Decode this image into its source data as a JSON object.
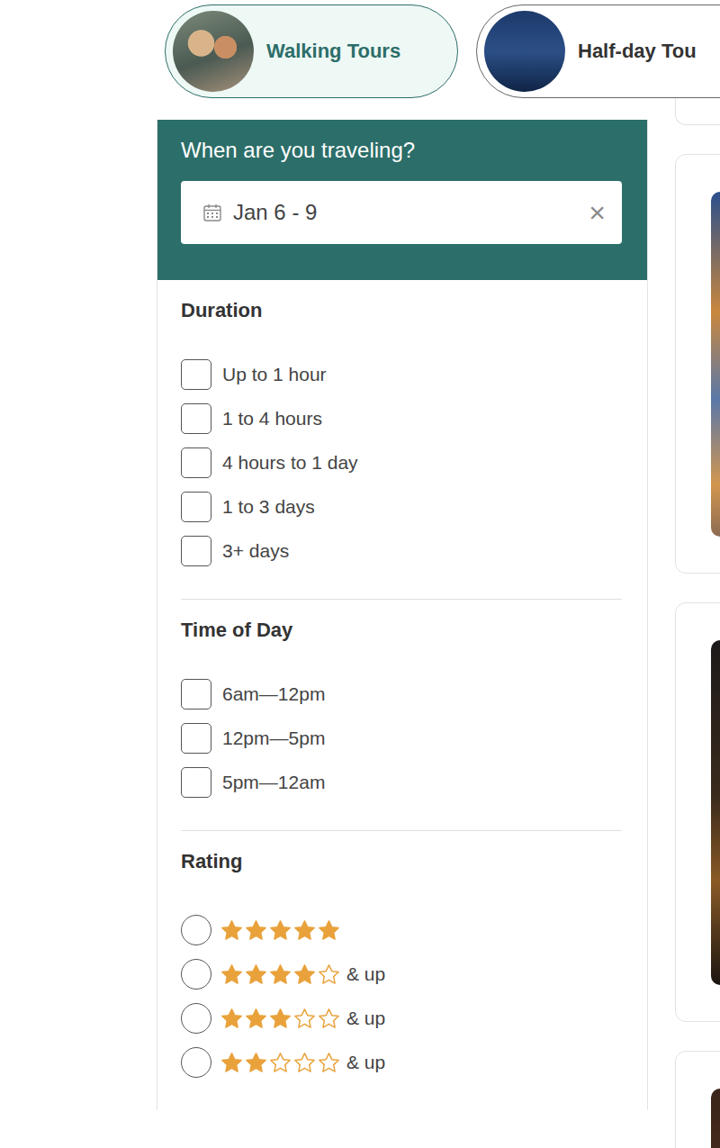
{
  "tabs": [
    {
      "label": "Walking Tours",
      "selected": true
    },
    {
      "label": "Half-day Tou",
      "selected": false
    }
  ],
  "date_picker": {
    "title": "When are you traveling?",
    "value": "Jan 6 - 9",
    "clear": "×"
  },
  "duration": {
    "title": "Duration",
    "options": [
      {
        "label": "Up to 1 hour",
        "checked": false
      },
      {
        "label": "1 to 4 hours",
        "checked": false
      },
      {
        "label": "4 hours to 1 day",
        "checked": false
      },
      {
        "label": "1 to 3 days",
        "checked": false
      },
      {
        "label": "3+ days",
        "checked": false
      }
    ]
  },
  "time_of_day": {
    "title": "Time of Day",
    "options": [
      {
        "label": "6am—12pm",
        "checked": false
      },
      {
        "label": "12pm—5pm",
        "checked": false
      },
      {
        "label": "5pm—12am",
        "checked": false
      }
    ]
  },
  "rating": {
    "title": "Rating",
    "options": [
      {
        "stars": 5,
        "selected": false
      },
      {
        "stars": 4,
        "suffix": "& up",
        "selected": false
      },
      {
        "stars": 3,
        "suffix": "& up",
        "selected": false
      },
      {
        "stars": 2,
        "suffix": "& up",
        "selected": false
      }
    ]
  }
}
